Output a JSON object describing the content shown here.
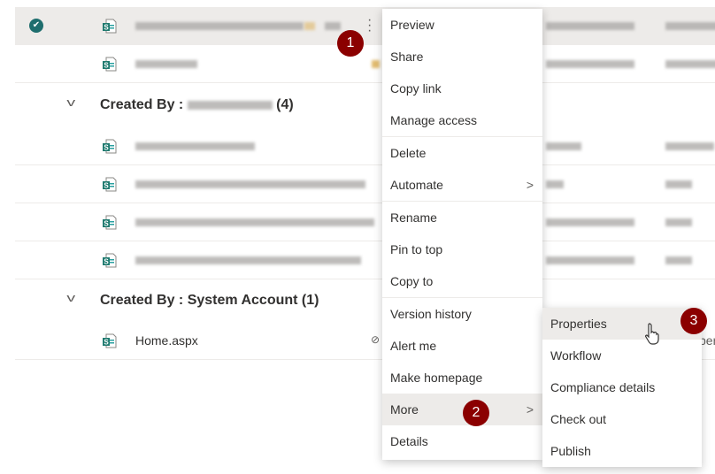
{
  "list": {
    "top_rows": [
      {
        "selected": true,
        "name_redacted": true
      },
      {
        "selected": false,
        "name_redacted": true
      }
    ],
    "groups": [
      {
        "label": "Created By : ",
        "owner_redacted": true,
        "count": "(4)"
      },
      {
        "label": "Created By : System Account",
        "count": "(1)"
      }
    ],
    "home_row": {
      "name": "Home.aspx",
      "suffix": "per"
    }
  },
  "context_menu": {
    "items": [
      "Preview",
      "Share",
      "Copy link",
      "Manage access",
      "Delete",
      "Automate",
      "Rename",
      "Pin to top",
      "Copy to",
      "Version history",
      "Alert me",
      "Make homepage",
      "More",
      "Details"
    ],
    "highlighted": "More"
  },
  "submenu": {
    "items": [
      "Properties",
      "Workflow",
      "Compliance details",
      "Check out",
      "Publish"
    ],
    "highlighted": "Properties"
  },
  "badges": [
    "1",
    "2",
    "3"
  ],
  "colors": {
    "badge": "#8b0000",
    "file_icon": "#1f7a6f",
    "highlight": "#edebe9"
  }
}
